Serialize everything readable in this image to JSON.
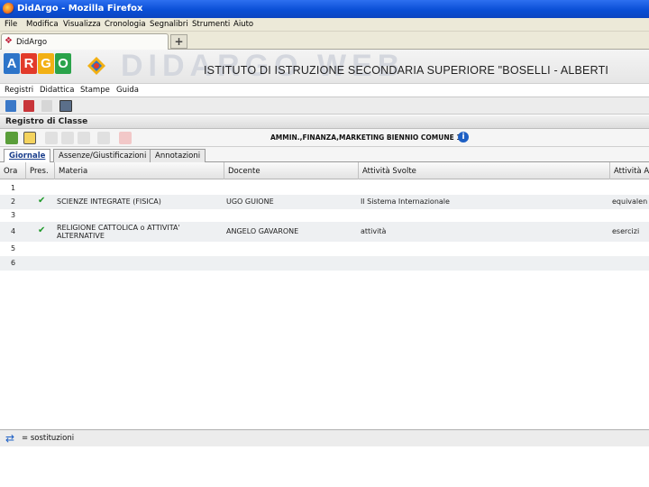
{
  "window": {
    "title": "DidArgo - Mozilla Firefox"
  },
  "browser_menu": [
    "File",
    "Modifica",
    "Visualizza",
    "Cronologia",
    "Segnalibri",
    "Strumenti",
    "Aiuto"
  ],
  "browser_tab": {
    "label": "DidArgo",
    "new_tab": "+"
  },
  "header": {
    "logo_letters": [
      "A",
      "R",
      "G",
      "O"
    ],
    "logo_colors": [
      "#2d74c9",
      "#e23a2a",
      "#f2b014",
      "#2aa34a"
    ],
    "watermark": "DIDARGO WEB",
    "school": "ISTITUTO DI ISTRUZIONE SECONDARIA SUPERIORE \"BOSELLI - ALBERTI"
  },
  "app_menu": [
    "Registri",
    "Didattica",
    "Stampe",
    "Guida"
  ],
  "panel": {
    "title": "Registro di Classe",
    "class_name": "AMMIN.,FINANZA,MARKETING BIENNIO COMUNE   1E",
    "info": "i"
  },
  "tabs": [
    {
      "label": "Giornale",
      "active": true
    },
    {
      "label": "Assenze/Giustificazioni",
      "active": false
    },
    {
      "label": "Annotazioni",
      "active": false
    }
  ],
  "table": {
    "columns": [
      "Ora",
      "Pres.",
      "Materia",
      "Docente",
      "Attività Svolte",
      "Attività A"
    ],
    "rows": [
      {
        "ora": "1",
        "pres": false,
        "materia": "",
        "docente": "",
        "attivita": "",
        "attivita_assegnate": ""
      },
      {
        "ora": "2",
        "pres": true,
        "materia": "SCIENZE INTEGRATE (FISICA)",
        "docente": "UGO GUIONE",
        "attivita": "Il Sistema Internazionale",
        "attivita_assegnate": "equivalen"
      },
      {
        "ora": "3",
        "pres": false,
        "materia": "",
        "docente": "",
        "attivita": "",
        "attivita_assegnate": ""
      },
      {
        "ora": "4",
        "pres": true,
        "materia": "RELIGIONE CATTOLICA o ATTIVITA' ALTERNATIVE",
        "docente": "ANGELO GAVARONE",
        "attivita": "attività",
        "attivita_assegnate": "esercizi"
      },
      {
        "ora": "5",
        "pres": false,
        "materia": "",
        "docente": "",
        "attivita": "",
        "attivita_assegnate": ""
      },
      {
        "ora": "6",
        "pres": false,
        "materia": "",
        "docente": "",
        "attivita": "",
        "attivita_assegnate": ""
      }
    ]
  },
  "status": {
    "text": "= sostituzioni"
  }
}
